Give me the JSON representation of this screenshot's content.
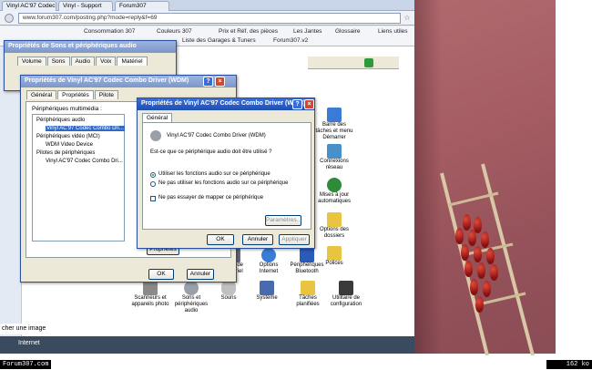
{
  "browser": {
    "tabs": [
      "Vinyl AC'97 Codec Combo Driver",
      "Vinyl - Support",
      "Forum307"
    ],
    "url": "www.forum307.com/posting.php?mode=reply&f=69",
    "bookmarks": [
      "Consommation 307",
      "Couleurs 307",
      "Prix et Réf. des pièces",
      "Les Jantes",
      "Glossaire",
      "Liens utiles",
      "Liste des Garages & Tuners",
      "Forum307.v2"
    ],
    "status": "Internet",
    "left_text": "cher une image"
  },
  "sound_window": {
    "title": "Propriétés de Sons et périphériques audio",
    "tabs": [
      "Volume",
      "Sons",
      "Audio",
      "Voix",
      "Matériel"
    ]
  },
  "codec_window": {
    "title": "Propriétés de Vinyl AC'97 Codec Combo Driver (WDM)",
    "tabs": [
      "Général",
      "Propriétés",
      "Pilote"
    ],
    "section_label": "Périphériques multimédia :",
    "tree": [
      "Périphériques audio",
      "Vinyl AC'97 Codec Combo Dri...",
      "Périphériques vidéo (MCI)",
      "WDM Video Device",
      "Pilotes de périphériques",
      "Vinyl AC'97 Codec Combo Dri..."
    ],
    "properties_btn": "Propriétés",
    "ok": "OK",
    "cancel": "Annuler"
  },
  "driver_dialog": {
    "title": "Propriétés de Vinyl AC'97 Codec Combo Driver (WDM)",
    "tab": "Général",
    "device_name": "Vinyl AC'97 Codec Combo Driver (WDM)",
    "question": "Est-ce que ce périphérique audio doit être utilisé ?",
    "options": [
      "Utiliser les fonctions audio sur ce périphérique",
      "Ne pas utiliser les fonctions audio sur ce périphérique"
    ],
    "checkbox": "Ne pas essayer de mapper ce périphérique",
    "settings_btn": "Paramètres...",
    "ok": "OK",
    "cancel": "Annuler",
    "apply": "Appliquer"
  },
  "control_panel": {
    "items": [
      {
        "label": "Barre des tâches et menu Démarrer",
        "icon": "taskbar-icon",
        "color": "#3b7bd6"
      },
      {
        "label": "Connexions réseau",
        "icon": "network-icon",
        "color": "#4a90c8"
      },
      {
        "label": "Mises à jour automatiques",
        "icon": "shield-icon",
        "color": "#2e8b3a"
      },
      {
        "label": "Options des dossiers",
        "icon": "folder-icon",
        "color": "#e8c440"
      },
      {
        "label": "Polices",
        "icon": "fonts-icon",
        "color": "#e8c440"
      },
      {
        "label": "Ajout de matériel",
        "icon": "hardware-icon",
        "color": "#6a6a8a"
      },
      {
        "label": "Options Internet",
        "icon": "globe-icon",
        "color": "#3a7bd5"
      },
      {
        "label": "Périphériques Bluetooth",
        "icon": "bluetooth-icon",
        "color": "#2a5bb8"
      },
      {
        "label": "Scanneurs et appareils photo",
        "icon": "scanner-icon",
        "color": "#8a8a8a"
      },
      {
        "label": "Sons et périphériques audio",
        "icon": "speaker-icon",
        "color": "#9aa0a8"
      },
      {
        "label": "Souris",
        "icon": "mouse-icon",
        "color": "#c0c0c0"
      },
      {
        "label": "Système",
        "icon": "system-icon",
        "color": "#4a6ab0"
      },
      {
        "label": "Tâches planifiées",
        "icon": "tasks-icon",
        "color": "#e8c440"
      },
      {
        "label": "Utilitaire de configuration",
        "icon": "config-icon",
        "color": "#3a3a3a"
      }
    ]
  },
  "footer": {
    "left": "Forum307.com",
    "right": "162 ko"
  }
}
